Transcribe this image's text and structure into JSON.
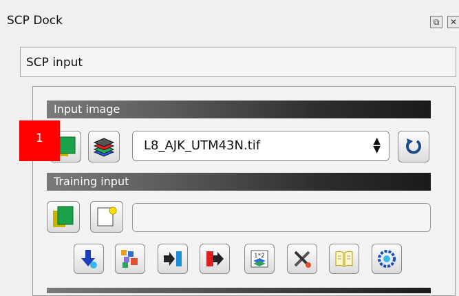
{
  "dock": {
    "title": "SCP Dock",
    "float_glyph": "⧉",
    "close_glyph": "✕"
  },
  "tab": {
    "label": "SCP input"
  },
  "input_image": {
    "header": "Input image",
    "selected_raster": "L8_AJK_UTM43N.tif"
  },
  "training_input": {
    "header": "Training input",
    "path_value": ""
  },
  "marker": {
    "label": "1"
  },
  "colors": {
    "marker": "#ff0000",
    "header_dark": "#1a1a1a",
    "header_light": "#7a7a7a",
    "refresh_blue": "#1a4a8a"
  },
  "icons": [
    "open-input-image-icon",
    "band-set-icon",
    "refresh-icon",
    "open-training-input-icon",
    "new-training-input-icon",
    "download-icon",
    "pansharpen-icon",
    "import-icon",
    "export-icon",
    "band-calc-icon",
    "tools-icon",
    "documentation-icon",
    "settings-icon"
  ]
}
